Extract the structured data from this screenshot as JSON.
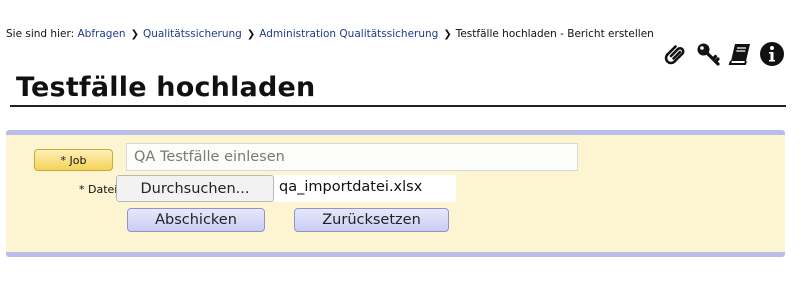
{
  "breadcrumb": {
    "prefix": "Sie sind hier:",
    "items": [
      "Abfragen",
      "Qualitätssicherung",
      "Administration Qualitätssicherung"
    ],
    "current": "Testfälle hochladen - Bericht erstellen"
  },
  "toolbar": {
    "icons": [
      "paperclip-icon",
      "key-icon",
      "book-icon",
      "info-icon"
    ]
  },
  "page": {
    "title": "Testfälle hochladen"
  },
  "form": {
    "job_label": "* Job",
    "job_value": "",
    "job_placeholder": "QA Testfälle einlesen",
    "datei_label": "* Datei",
    "browse_label": "Durchsuchen...",
    "file_name": "qa_importdatei.xlsx",
    "submit_label": "Abschicken",
    "reset_label": "Zurücksetzen"
  },
  "colors": {
    "panel_bg": "#fdf4d1",
    "panel_border": "#b9bde8",
    "link": "#1f3b8c",
    "button_bg": "#c9cdf3"
  }
}
